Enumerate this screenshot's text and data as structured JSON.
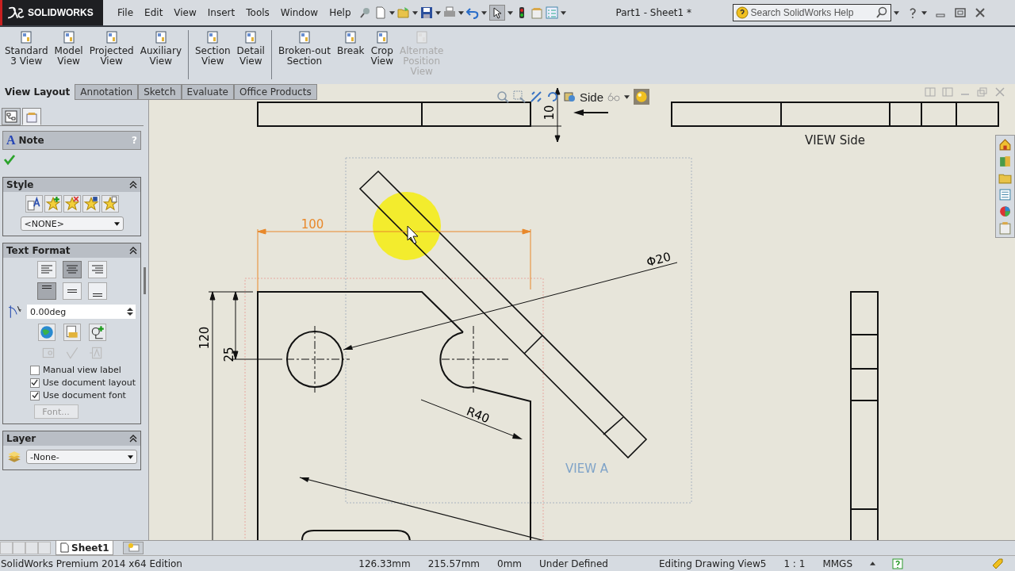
{
  "title_bar": {
    "logo": "SOLIDWORKS",
    "menus": [
      "File",
      "Edit",
      "View",
      "Insert",
      "Tools",
      "Window",
      "Help"
    ],
    "document_title": "Part1 - Sheet1 *",
    "search": {
      "placeholder": "Search SolidWorks Help"
    }
  },
  "ribbon": {
    "groups": [
      {
        "buttons": [
          {
            "lines": [
              "Standard",
              "3 View"
            ],
            "disabled": false
          },
          {
            "lines": [
              "Model",
              "View"
            ],
            "disabled": false
          },
          {
            "lines": [
              "Projected",
              "View"
            ],
            "disabled": false
          },
          {
            "lines": [
              "Auxiliary",
              "View"
            ],
            "disabled": false
          }
        ]
      },
      {
        "buttons": [
          {
            "lines": [
              "Section",
              "View"
            ],
            "disabled": false
          },
          {
            "lines": [
              "Detail",
              "View"
            ],
            "disabled": false
          }
        ]
      },
      {
        "buttons": [
          {
            "lines": [
              "Broken-out",
              "Section"
            ],
            "disabled": false
          },
          {
            "lines": [
              "Break"
            ],
            "disabled": false
          },
          {
            "lines": [
              "Crop",
              "View"
            ],
            "disabled": false
          },
          {
            "lines": [
              "Alternate",
              "Position",
              "View"
            ],
            "disabled": true
          }
        ]
      }
    ]
  },
  "command_tabs": [
    {
      "label": "View Layout",
      "selected": true
    },
    {
      "label": "Annotation",
      "selected": false
    },
    {
      "label": "Sketch",
      "selected": false
    },
    {
      "label": "Evaluate",
      "selected": false
    },
    {
      "label": "Office Products",
      "selected": false
    }
  ],
  "panel": {
    "tabs": [
      {
        "selected": false
      },
      {
        "selected": true
      }
    ],
    "icon_letter": "A",
    "title": "Note",
    "help": "?",
    "style": {
      "title": "Style",
      "dropdown": "<NONE>"
    },
    "text_format": {
      "title": "Text Format",
      "horizontal_align": [
        {
          "selected": false
        },
        {
          "selected": true
        },
        {
          "selected": false
        }
      ],
      "vertical_align": [
        {
          "selected": true
        },
        {
          "selected": false
        },
        {
          "selected": false
        }
      ],
      "angle": "0.00deg",
      "checkboxes": [
        {
          "label": "Manual view label",
          "checked": false
        },
        {
          "label": "Use document layout",
          "checked": true
        },
        {
          "label": "Use document font",
          "checked": true
        }
      ],
      "font_button": {
        "label": "Font...",
        "disabled": true
      }
    },
    "layer": {
      "title": "Layer",
      "dropdown": "-None-"
    }
  },
  "heads_up": {
    "view": "Side"
  },
  "drawing": {
    "annotations": [
      "100",
      "Φ20",
      "120",
      "25",
      "R40",
      "10"
    ],
    "view_labels": [
      "VIEW Side",
      "VIEW A"
    ]
  },
  "sheet_tabs": [
    {
      "label": "Sheet1",
      "selected": true
    }
  ],
  "status_bar": {
    "edition": "SolidWorks Premium 2014 x64 Edition",
    "fields": [
      "126.33mm",
      "215.57mm",
      "0mm",
      "Under Defined",
      "Editing Drawing View5",
      "1 : 1",
      "MMGS"
    ]
  }
}
